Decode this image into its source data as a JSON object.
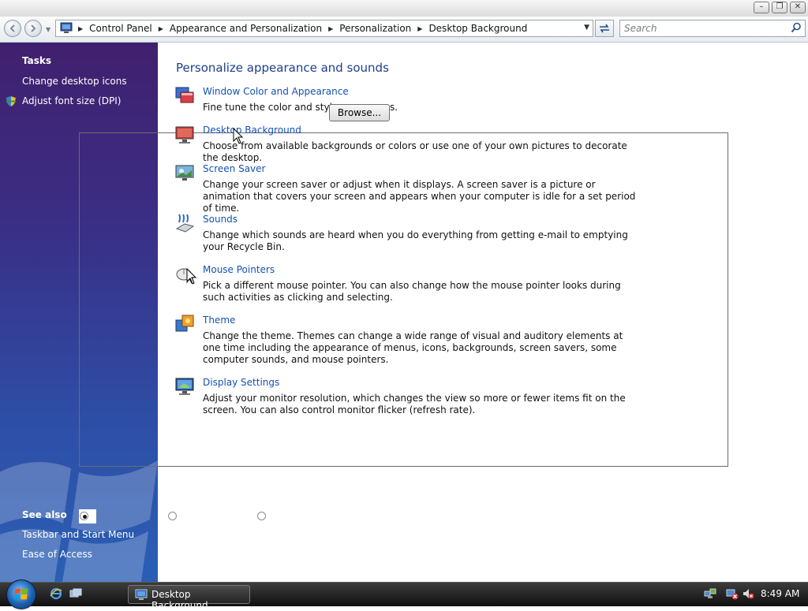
{
  "window": {
    "minimize_glyph": "–",
    "maximize_glyph": "❐",
    "close_glyph": "✕"
  },
  "address_bar": {
    "breadcrumbs": [
      "Control Panel",
      "Appearance and Personalization",
      "Personalization",
      "Desktop Background"
    ],
    "search_placeholder": "Search"
  },
  "left_pane": {
    "tasks_heading": "Tasks",
    "tasks": [
      "Change desktop icons",
      "Adjust font size (DPI)"
    ],
    "see_also_heading": "See also",
    "see_also": [
      "Taskbar and Start Menu",
      "Ease of Access"
    ]
  },
  "main": {
    "title": "Personalize appearance and sounds",
    "items": [
      {
        "icon": "window-color-icon",
        "link": "Window Color and Appearance",
        "desc": "Fine tune the color and style o"
      },
      {
        "icon": "desktop-background-icon",
        "link": "Desktop Background",
        "desc": "Choose from available backgrounds or colors or use one of your own pictures to decorate the desktop."
      },
      {
        "icon": "screen-saver-icon",
        "link": "Screen Saver",
        "desc": "Change your screen saver or adjust when it displays. A screen saver is a picture or animation that covers your screen and appears when your computer is idle for a set period of time."
      },
      {
        "icon": "sounds-icon",
        "link": "Sounds",
        "desc": "Change which sounds are heard when you do everything from getting e-mail to emptying your Recycle Bin."
      },
      {
        "icon": "mouse-pointers-icon",
        "link": "Mouse Pointers",
        "desc": "Pick a different mouse pointer. You can also change how the mouse pointer looks during such activities as clicking and selecting."
      },
      {
        "icon": "theme-icon",
        "link": "Theme",
        "desc": "Change the theme. Themes can change a wide range of visual and auditory elements at one time including the appearance of menus, icons, backgrounds, screen savers, some computer sounds, and mouse pointers."
      },
      {
        "icon": "display-settings-icon",
        "link": "Display Settings",
        "desc": "Adjust your monitor resolution, which changes the view so more or fewer items fit on the screen. You can also control monitor flicker (refresh rate)."
      }
    ],
    "desc_tail": "s.",
    "browse_label": "Browse..."
  },
  "taskbar": {
    "task_label": "Desktop Background",
    "clock": "8:49 AM"
  }
}
